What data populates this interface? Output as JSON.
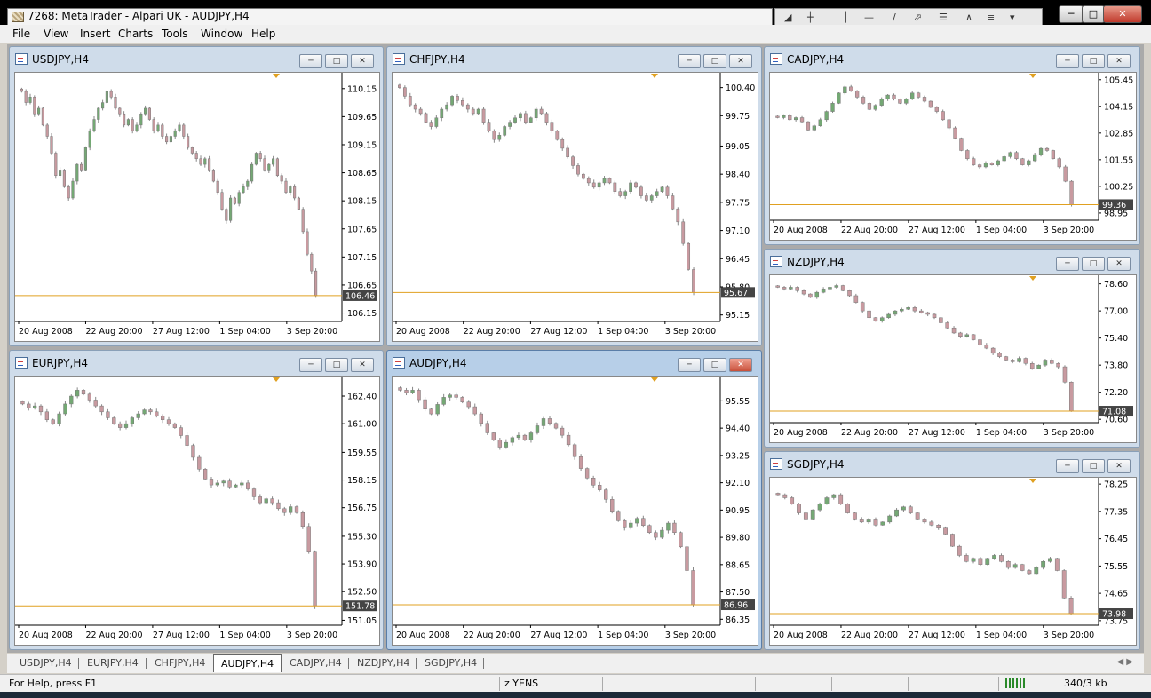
{
  "window": {
    "title": "7268: MetaTrader - Alpari UK - AUDJPY,H4"
  },
  "menu": [
    "File",
    "View",
    "Insert",
    "Charts",
    "Tools",
    "Window",
    "Help"
  ],
  "toolbar_icons": [
    "cursor-icon",
    "crosshair-icon",
    "vertical-line-icon",
    "horizontal-line-icon",
    "trendline-icon",
    "channel-icon",
    "fibonacci-icon",
    "text-icon",
    "arrow-icon"
  ],
  "charts": [
    {
      "id": "usdjpy",
      "title": "USDJPY,H4",
      "active": false,
      "price_label": "106.46",
      "y_ticks": [
        "110.15",
        "109.65",
        "109.15",
        "108.65",
        "108.15",
        "107.65",
        "107.15",
        "106.65",
        "106.15"
      ],
      "x_ticks": [
        "20 Aug 2008",
        "22 Aug 20:00",
        "27 Aug 12:00",
        "1 Sep 04:00",
        "3 Sep 20:00"
      ],
      "ylim": [
        106.0,
        110.4
      ],
      "line": 106.46,
      "closes": [
        110.1,
        109.9,
        110.0,
        109.7,
        109.8,
        109.5,
        109.3,
        109.0,
        108.6,
        108.7,
        108.4,
        108.2,
        108.5,
        108.8,
        108.7,
        109.1,
        109.4,
        109.6,
        109.8,
        109.9,
        110.1,
        110.0,
        109.8,
        109.7,
        109.5,
        109.6,
        109.4,
        109.5,
        109.7,
        109.8,
        109.6,
        109.4,
        109.5,
        109.3,
        109.2,
        109.3,
        109.4,
        109.5,
        109.3,
        109.1,
        109.0,
        108.9,
        108.8,
        108.9,
        108.7,
        108.5,
        108.3,
        108.0,
        107.8,
        108.2,
        108.1,
        108.3,
        108.4,
        108.5,
        108.8,
        109.0,
        108.9,
        108.7,
        108.8,
        108.9,
        108.6,
        108.5,
        108.3,
        108.4,
        108.2,
        108.0,
        107.6,
        107.2,
        106.9,
        106.46
      ]
    },
    {
      "id": "chfjpy",
      "title": "CHFJPY,H4",
      "active": false,
      "price_label": "95.67",
      "y_ticks": [
        "100.40",
        "99.75",
        "99.05",
        "98.40",
        "97.75",
        "97.10",
        "96.45",
        "95.80",
        "95.15"
      ],
      "x_ticks": [
        "20 Aug 2008",
        "22 Aug 20:00",
        "27 Aug 12:00",
        "1 Sep 04:00",
        "3 Sep 20:00"
      ],
      "ylim": [
        95.0,
        100.7
      ],
      "line": 95.67,
      "closes": [
        100.4,
        100.2,
        100.0,
        99.9,
        99.8,
        99.6,
        99.5,
        99.7,
        99.9,
        100.0,
        100.2,
        100.1,
        100.0,
        99.9,
        99.8,
        99.9,
        99.6,
        99.4,
        99.2,
        99.3,
        99.5,
        99.6,
        99.7,
        99.8,
        99.6,
        99.7,
        99.9,
        99.8,
        99.6,
        99.4,
        99.2,
        99.0,
        98.8,
        98.6,
        98.4,
        98.3,
        98.2,
        98.1,
        98.2,
        98.3,
        98.2,
        98.0,
        97.9,
        98.0,
        98.2,
        98.1,
        97.9,
        97.8,
        97.9,
        98.0,
        98.1,
        97.9,
        97.6,
        97.3,
        96.8,
        96.2,
        95.67
      ]
    },
    {
      "id": "cadjpy",
      "title": "CADJPY,H4",
      "active": false,
      "price_label": "99.36",
      "y_ticks": [
        "105.45",
        "104.15",
        "102.85",
        "101.55",
        "100.25",
        "98.95"
      ],
      "x_ticks": [
        "20 Aug 2008",
        "22 Aug 20:00",
        "27 Aug 12:00",
        "1 Sep 04:00",
        "3 Sep 20:00"
      ],
      "ylim": [
        98.6,
        105.7
      ],
      "line": 99.36,
      "closes": [
        103.6,
        103.7,
        103.5,
        103.6,
        103.4,
        103.0,
        103.2,
        103.5,
        103.9,
        104.3,
        104.8,
        105.1,
        104.9,
        104.6,
        104.3,
        104.0,
        104.2,
        104.5,
        104.7,
        104.5,
        104.3,
        104.5,
        104.8,
        104.6,
        104.4,
        104.1,
        103.9,
        103.5,
        103.1,
        102.6,
        102.0,
        101.6,
        101.3,
        101.2,
        101.4,
        101.3,
        101.5,
        101.7,
        101.9,
        101.6,
        101.3,
        101.5,
        101.8,
        102.1,
        102.0,
        101.6,
        101.2,
        100.5,
        99.36
      ]
    },
    {
      "id": "eurjpy",
      "title": "EURJPY,H4",
      "active": false,
      "price_label": "151.78",
      "y_ticks": [
        "162.40",
        "161.00",
        "159.55",
        "158.15",
        "156.75",
        "155.30",
        "153.90",
        "152.50",
        "151.05"
      ],
      "x_ticks": [
        "20 Aug 2008",
        "22 Aug 20:00",
        "27 Aug 12:00",
        "1 Sep 04:00",
        "3 Sep 20:00"
      ],
      "ylim": [
        150.8,
        163.3
      ],
      "line": 151.78,
      "closes": [
        162.0,
        161.8,
        161.9,
        161.6,
        161.2,
        161.0,
        161.5,
        162.0,
        162.4,
        162.7,
        162.5,
        162.2,
        161.9,
        161.6,
        161.3,
        161.0,
        160.8,
        161.0,
        161.3,
        161.5,
        161.7,
        161.6,
        161.4,
        161.2,
        161.0,
        160.8,
        160.4,
        159.9,
        159.3,
        158.7,
        158.2,
        157.9,
        158.0,
        158.1,
        157.8,
        157.9,
        158.0,
        157.7,
        157.3,
        157.0,
        157.2,
        157.0,
        156.7,
        156.5,
        156.8,
        156.5,
        155.8,
        154.5,
        151.78
      ]
    },
    {
      "id": "audjpy",
      "title": "AUDJPY,H4",
      "active": true,
      "price_label": "86.96",
      "y_ticks": [
        "95.55",
        "94.40",
        "93.25",
        "92.10",
        "90.95",
        "89.80",
        "88.65",
        "87.50",
        "86.35"
      ],
      "x_ticks": [
        "20 Aug 2008",
        "22 Aug 20:00",
        "27 Aug 12:00",
        "1 Sep 04:00",
        "3 Sep 20:00"
      ],
      "ylim": [
        86.1,
        96.5
      ],
      "line": 86.96,
      "closes": [
        96.0,
        95.9,
        96.0,
        95.6,
        95.2,
        95.0,
        95.4,
        95.7,
        95.8,
        95.7,
        95.5,
        95.3,
        95.0,
        94.6,
        94.2,
        93.9,
        93.6,
        93.8,
        94.0,
        94.1,
        93.9,
        94.2,
        94.5,
        94.8,
        94.6,
        94.4,
        94.1,
        93.7,
        93.2,
        92.7,
        92.3,
        92.0,
        91.8,
        91.4,
        90.9,
        90.5,
        90.2,
        90.4,
        90.6,
        90.3,
        90.0,
        89.8,
        90.1,
        90.4,
        90.0,
        89.4,
        88.4,
        86.96
      ]
    },
    {
      "id": "nzdjpy",
      "title": "NZDJPY,H4",
      "active": false,
      "price_label": "71.08",
      "y_ticks": [
        "78.60",
        "77.00",
        "75.40",
        "73.80",
        "72.20",
        "70.60"
      ],
      "x_ticks": [
        "20 Aug 2008",
        "22 Aug 20:00",
        "27 Aug 12:00",
        "1 Sep 04:00",
        "3 Sep 20:00"
      ],
      "ylim": [
        70.4,
        79.0
      ],
      "line": 71.08,
      "closes": [
        78.4,
        78.3,
        78.4,
        78.2,
        78.0,
        77.8,
        78.1,
        78.3,
        78.4,
        78.5,
        78.2,
        77.9,
        77.5,
        77.0,
        76.6,
        76.4,
        76.6,
        76.8,
        77.0,
        77.1,
        77.2,
        77.0,
        76.9,
        76.8,
        76.6,
        76.3,
        76.0,
        75.7,
        75.5,
        75.6,
        75.3,
        75.0,
        74.8,
        74.5,
        74.3,
        74.1,
        74.0,
        74.2,
        73.9,
        73.6,
        73.8,
        74.1,
        73.9,
        73.7,
        72.8,
        71.08
      ]
    },
    {
      "id": "sgdjpy",
      "title": "SGDJPY,H4",
      "active": false,
      "price_label": "73.98",
      "y_ticks": [
        "78.25",
        "77.35",
        "76.45",
        "75.55",
        "74.65",
        "73.75"
      ],
      "x_ticks": [
        "20 Aug 2008",
        "22 Aug 20:00",
        "27 Aug 12:00",
        "1 Sep 04:00",
        "3 Sep 20:00"
      ],
      "ylim": [
        73.6,
        78.4
      ],
      "line": 73.98,
      "closes": [
        77.9,
        77.8,
        77.6,
        77.3,
        77.1,
        77.4,
        77.6,
        77.8,
        77.9,
        77.6,
        77.3,
        77.1,
        77.0,
        77.1,
        76.9,
        77.0,
        77.2,
        77.4,
        77.5,
        77.3,
        77.1,
        77.0,
        76.9,
        76.8,
        76.6,
        76.2,
        75.9,
        75.7,
        75.8,
        75.6,
        75.8,
        75.9,
        75.7,
        75.5,
        75.6,
        75.4,
        75.3,
        75.5,
        75.7,
        75.8,
        75.4,
        74.5,
        73.98
      ]
    }
  ],
  "tabs": [
    "USDJPY,H4",
    "EURJPY,H4",
    "CHFJPY,H4",
    "AUDJPY,H4",
    "CADJPY,H4",
    "NZDJPY,H4",
    "SGDJPY,H4"
  ],
  "active_tab": "AUDJPY,H4",
  "status": {
    "help": "For Help, press F1",
    "profile": "z YENS",
    "traffic": "340/3 kb"
  },
  "colors": {
    "bull": "#74a874",
    "bear": "#c89aa0",
    "level": "#e0a020",
    "triangle": "#e0a020"
  }
}
